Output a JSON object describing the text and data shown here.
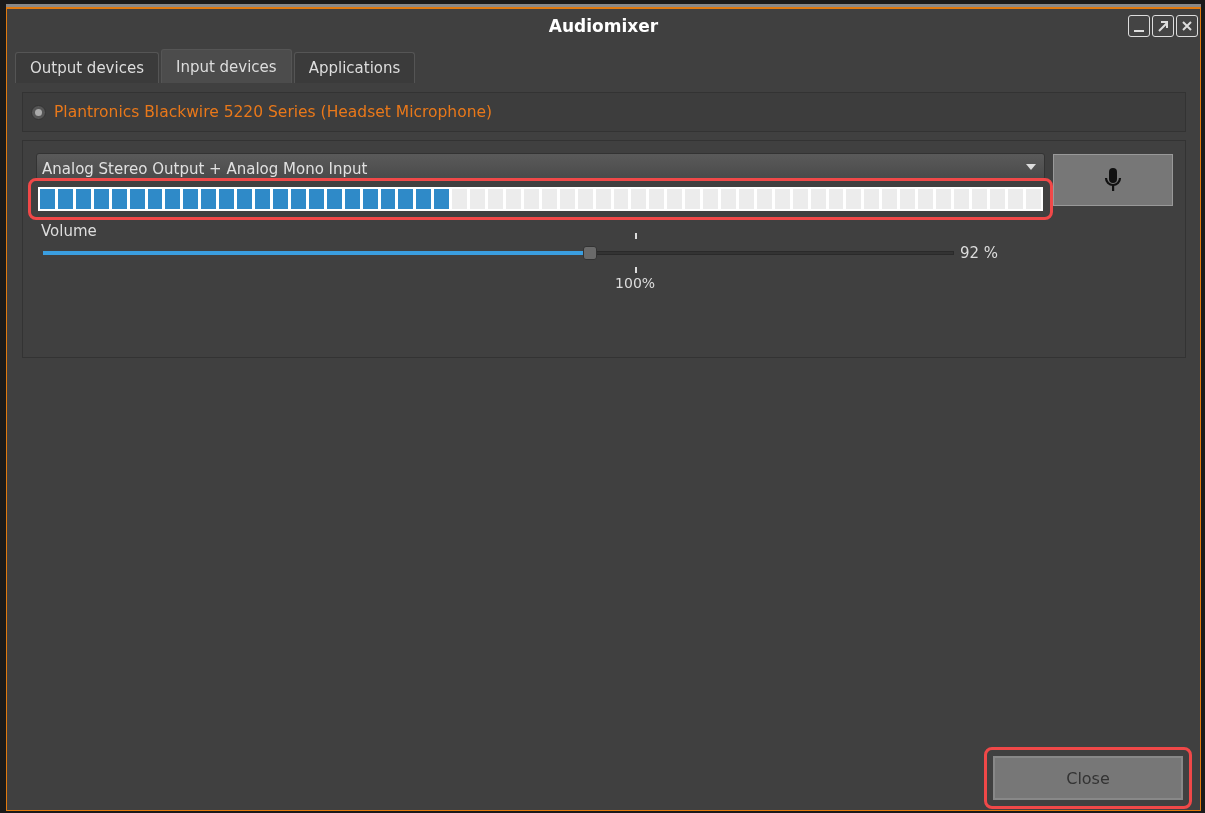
{
  "window": {
    "title": "Audiomixer"
  },
  "tabs": [
    {
      "label": "Output devices",
      "selected": false
    },
    {
      "label": "Input devices",
      "selected": true
    },
    {
      "label": "Applications",
      "selected": false
    }
  ],
  "device": {
    "name": "Plantronics Blackwire 5220 Series (Headset Microphone)",
    "selected": true
  },
  "profile": {
    "value": "Analog Stereo Output + Analog Mono Input"
  },
  "meter": {
    "level": 0.41,
    "highlighted": true
  },
  "mute_button": {
    "muted": false
  },
  "volume": {
    "label": "Volume",
    "level": 0.6,
    "reading": "92 %",
    "mark": "100%"
  },
  "close_button": {
    "label": "Close",
    "highlighted": true
  }
}
